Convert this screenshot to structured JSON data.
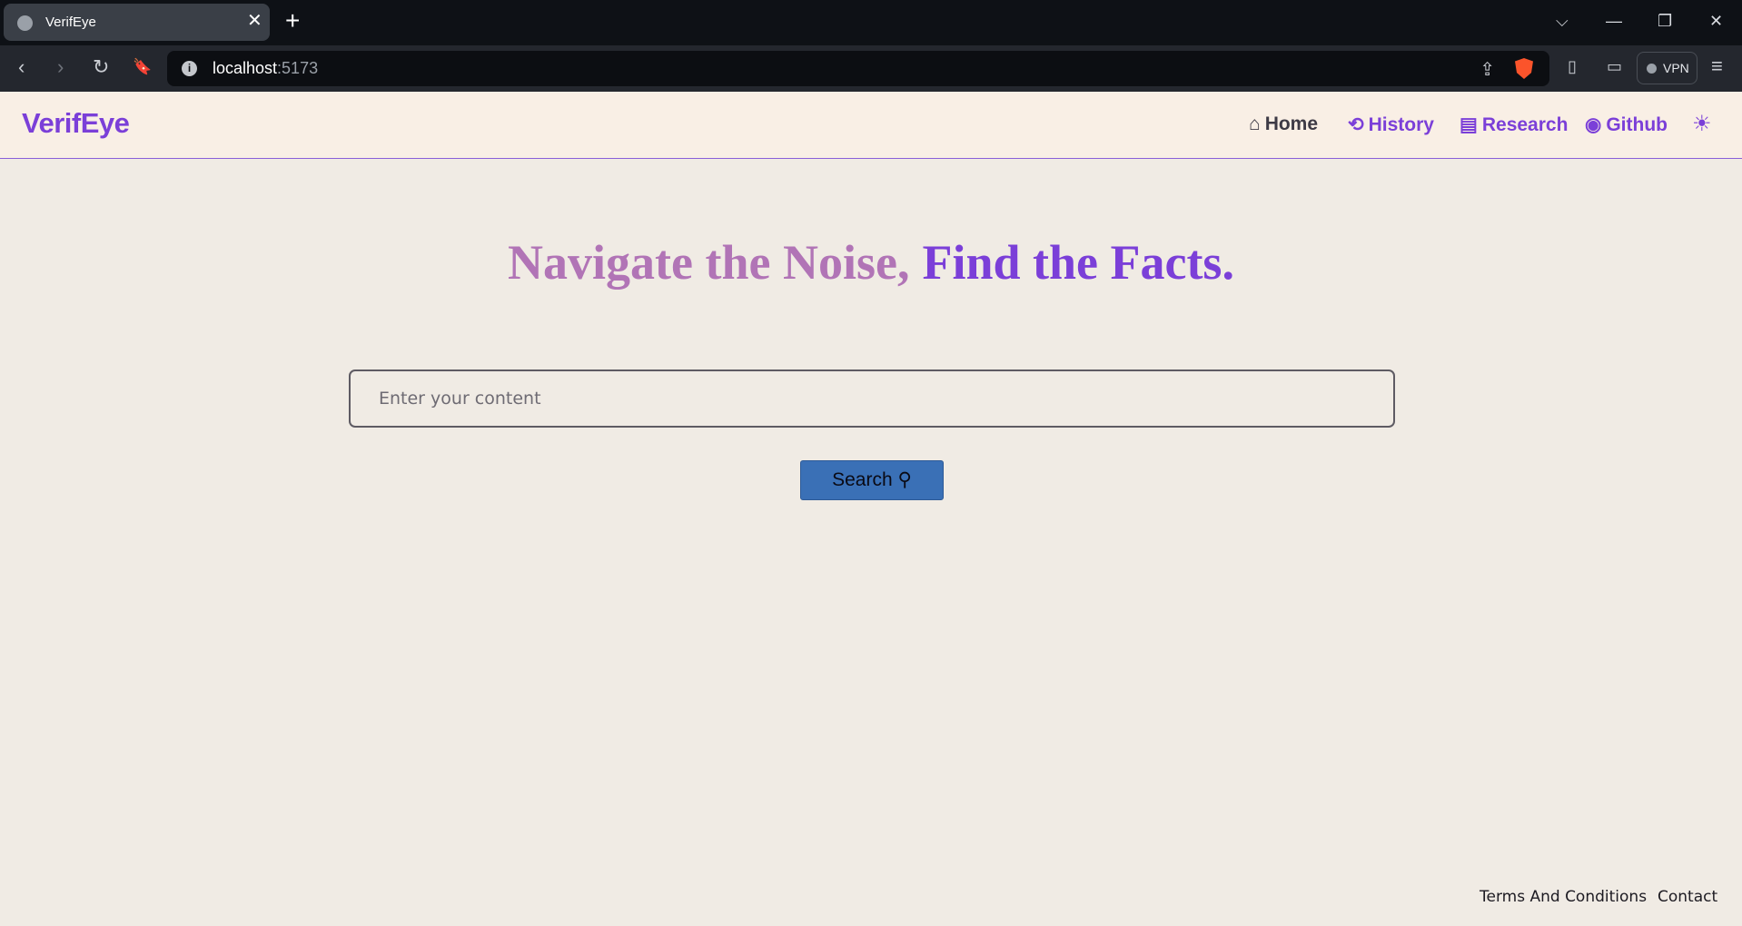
{
  "browser": {
    "tab_title": "VerifEye",
    "tab_close": "✕",
    "new_tab": "+",
    "url_host": "localhost",
    "url_port": ":5173",
    "vpn_label": "VPN",
    "window_controls": {
      "dropdown": "⌵",
      "minimize": "—",
      "restore": "❐",
      "close": "✕"
    },
    "nav_icons": {
      "back": "‹",
      "forward": "›",
      "reload": "↻",
      "bookmark": "🔖",
      "info": "i",
      "share": "⇪",
      "sidebar": "▯",
      "wallet": "▭",
      "menu": "≡"
    }
  },
  "navbar": {
    "brand": "VerifEye",
    "links": [
      {
        "label": "Home",
        "icon": "home-icon",
        "glyph": "⌂"
      },
      {
        "label": "History",
        "icon": "history-icon",
        "glyph": "⟲"
      },
      {
        "label": "Research",
        "icon": "document-icon",
        "glyph": "▤"
      },
      {
        "label": "Github",
        "icon": "github-icon",
        "glyph": "◉"
      }
    ],
    "theme_toggle_glyph": "☀"
  },
  "hero": {
    "headline_part1": "Navigate the Noise,",
    "headline_part2": "Find the Facts."
  },
  "search": {
    "placeholder": "Enter your content",
    "button_label": "Search",
    "button_glyph": "⚲"
  },
  "footer": {
    "terms": "Terms And Conditions",
    "contact": "Contact"
  },
  "colors": {
    "accent": "#7b3fd8",
    "headline_muted": "#b174b6",
    "button": "#3a70b6",
    "page_bg": "#f0ebe4",
    "nav_bg": "#f9efe5"
  }
}
